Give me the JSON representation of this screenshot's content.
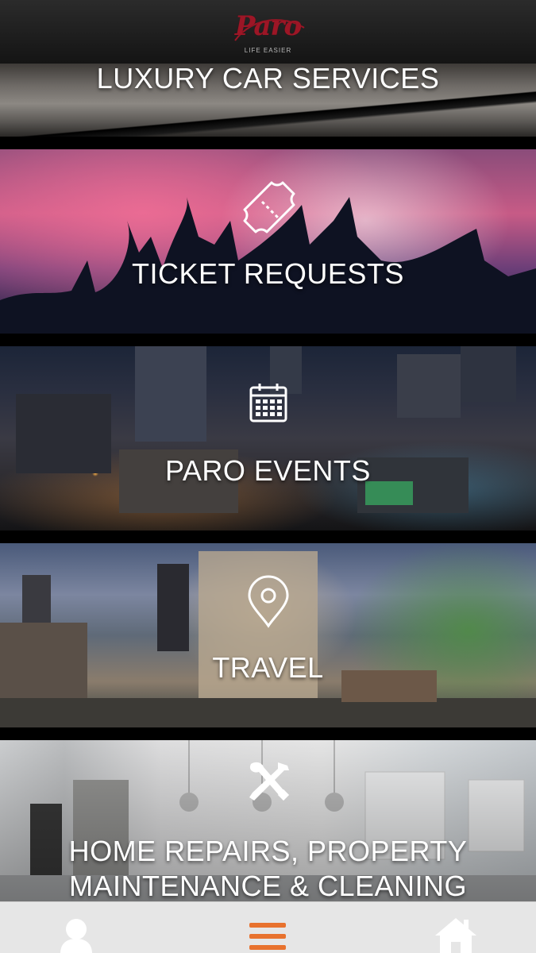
{
  "header": {
    "logo_text": "Paro",
    "logo_tagline": "LIFE EASIER",
    "brand_color": "#9c1626"
  },
  "tiles": [
    {
      "label": "LUXURY CAR SERVICES",
      "icon": ""
    },
    {
      "label": "TICKET REQUESTS",
      "icon": "ticket-icon"
    },
    {
      "label": "PARO EVENTS",
      "icon": "calendar-icon"
    },
    {
      "label": "TRAVEL",
      "icon": "location-pin-icon"
    },
    {
      "label": "HOME REPAIRS, PROPERTY MAINTENANCE & CLEANING",
      "icon": "tools-icon"
    }
  ],
  "tabbar": {
    "items": [
      {
        "icon": "profile-icon",
        "active": false
      },
      {
        "icon": "menu-icon",
        "active": true
      },
      {
        "icon": "home-icon",
        "active": false
      }
    ],
    "active_color": "#e8722e",
    "inactive_color": "#ffffff"
  }
}
